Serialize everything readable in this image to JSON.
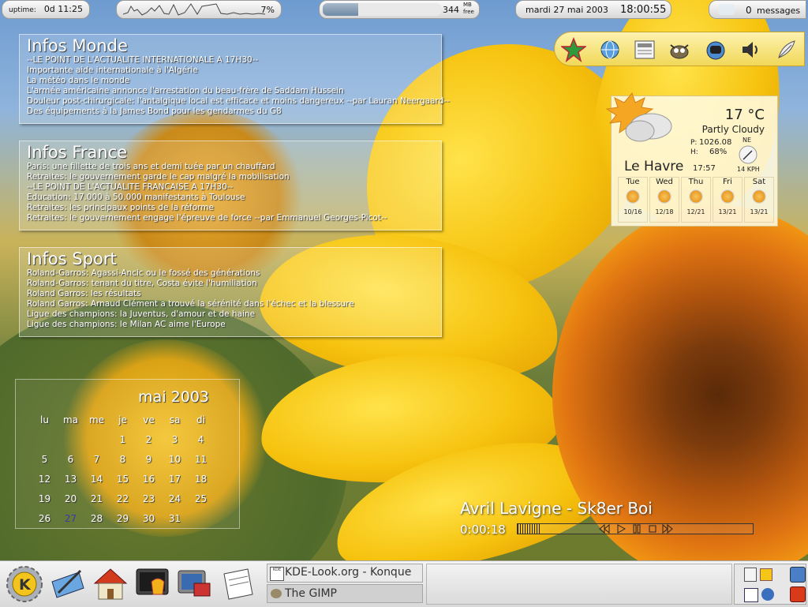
{
  "top_bar": {
    "uptime_label": "uptime:",
    "uptime_value": "0d 11:25",
    "cpu_percent": "7%",
    "cpu_level": 0.07,
    "mem_value": "344",
    "mem_unit_top": "MB",
    "mem_unit_bottom": "free",
    "mem_level": 0.3,
    "date": "mardi 27 mai 2003",
    "time": "18:00:55",
    "messages_count": "0",
    "messages_label": "messages"
  },
  "news": [
    {
      "title": "Infos Monde",
      "lines": [
        "--LE POINT DE L'ACTUALITE INTERNATIONALE A 17H30--",
        "Importante aide internationale à l'Algérie",
        "La météo dans le monde",
        "L'armée américaine annonce l'arrestation du beau-frère de Saddam Hussein",
        "Douleur post-chirurgicale: l'antalgique local est efficace et moins dangereux --par Lauran Neergaard--",
        "Des équipements à la James Bond pour les gendarmes du G8"
      ]
    },
    {
      "title": "Infos France",
      "lines": [
        "Paris: une fillette de trois ans et demi tuée par un chauffard",
        "Retraites: le gouvernement garde le cap malgré la mobilisation",
        "--LE POINT DE L'ACTUALITE FRANCAISE A 17H30--",
        "Education: 17.000 à 50.000 manifestants à Toulouse",
        "Retraites: les principaux points de la réforme",
        "Retraites: le gouvernement engage l'épreuve de force --par Emmanuel Georges-Picot--"
      ]
    },
    {
      "title": "Infos Sport",
      "lines": [
        "Roland-Garros: Agassi-Ancic ou le fossé des générations",
        "Roland-Garros: tenant du titre, Costa évite l'humiliation",
        "Roland Garros: les résultats",
        "Roland Garros: Arnaud Clément a trouvé la sérénité dans l'échec et la blessure",
        "Ligue des champions: la Juventus, d'amour et de haine",
        "Ligue des champions: le Milan AC aime l'Europe"
      ]
    }
  ],
  "launchers": [
    "star-icon",
    "globe-icon",
    "news-icon",
    "gimp-icon",
    "phone-icon",
    "speaker-icon",
    "feather-icon"
  ],
  "weather": {
    "temp": "17 °C",
    "condition": "Partly Cloudy",
    "pressure_label": "P:",
    "pressure": "1026.08",
    "humidity_label": "H:",
    "humidity": "68%",
    "wind_dir": "NE",
    "wind_speed": "14 KPH",
    "city": "Le Havre",
    "local_time": "17:57",
    "forecast": [
      {
        "day": "Tue",
        "temps": "10/16"
      },
      {
        "day": "Wed",
        "temps": "12/18"
      },
      {
        "day": "Thu",
        "temps": "12/21"
      },
      {
        "day": "Fri",
        "temps": "13/21"
      },
      {
        "day": "Sat",
        "temps": "13/21"
      }
    ]
  },
  "calendar": {
    "month": "mai 2003",
    "weekdays": [
      "lu",
      "ma",
      "me",
      "je",
      "ve",
      "sa",
      "di"
    ],
    "weeks": [
      [
        "",
        "",
        "",
        "1",
        "2",
        "3",
        "4"
      ],
      [
        "5",
        "6",
        "7",
        "8",
        "9",
        "10",
        "11"
      ],
      [
        "12",
        "13",
        "14",
        "15",
        "16",
        "17",
        "18"
      ],
      [
        "19",
        "20",
        "21",
        "22",
        "23",
        "24",
        "25"
      ],
      [
        "26",
        "27",
        "28",
        "29",
        "30",
        "31",
        ""
      ]
    ],
    "today": "27",
    "today_color": "#3a3aa8"
  },
  "player": {
    "track": "Avril Lavigne - Sk8er Boi",
    "elapsed": "0:00:18",
    "progress": 0.1
  },
  "taskbar": {
    "tasks": [
      {
        "label": "KDE-Look.org - Konque",
        "icon": "konqueror-icon"
      },
      {
        "label": "The GIMP",
        "icon": "gimp-icon"
      }
    ]
  }
}
